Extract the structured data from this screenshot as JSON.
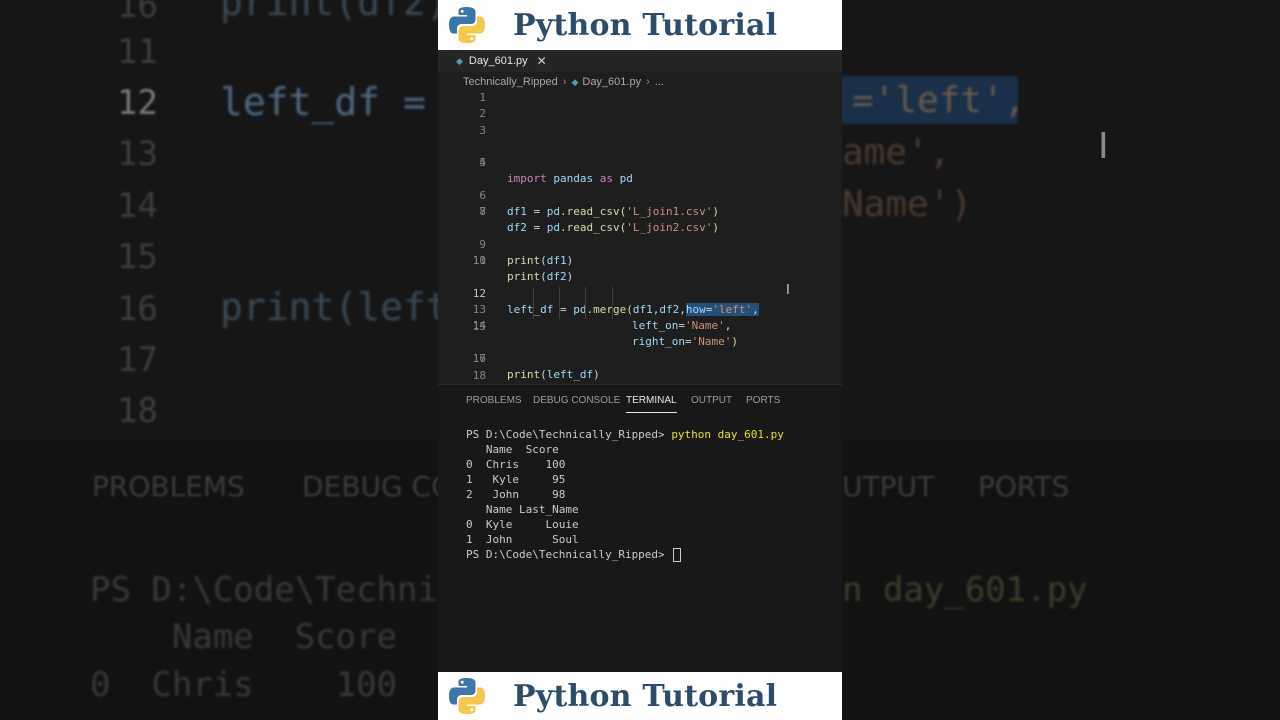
{
  "banner": {
    "title": "Python Tutorial"
  },
  "editor": {
    "tab_label": "Day_601.py",
    "close_glyph": "✕",
    "breadcrumb": {
      "folder": "Technically_Ripped",
      "file": "Day_601.py",
      "more": "..."
    },
    "lines": [
      {
        "n": "1"
      },
      {
        "n": "2"
      },
      {
        "n": "3"
      },
      {
        "n": "4",
        "import_kw": "import",
        "module": "pandas",
        "as_kw": "as",
        "alias": "pd"
      },
      {
        "n": "5"
      },
      {
        "n": "6",
        "var": "df1",
        "eq": " = ",
        "obj": "pd",
        "call": ".read_csv(",
        "str": "'L_join1.csv'",
        "close": ")"
      },
      {
        "n": "7",
        "var": "df2",
        "eq": " = ",
        "obj": "pd",
        "call": ".read_csv(",
        "str": "'L_join2.csv'",
        "close": ")"
      },
      {
        "n": "8"
      },
      {
        "n": "9",
        "fn": "print",
        "open": "(",
        "arg": "df1",
        "close": ")"
      },
      {
        "n": "10",
        "fn": "print",
        "open": "(",
        "arg": "df2",
        "close": ")"
      },
      {
        "n": "11"
      },
      {
        "n": "12",
        "var": "left_df",
        "eq": " = ",
        "obj": "pd",
        "call": ".merge(",
        "args": "df1,df2,",
        "kwarg": "how",
        "kweq": "=",
        "str": "'left'",
        "comma": ","
      },
      {
        "n": "13",
        "kwarg": "left_on",
        "kweq": "=",
        "str": "'Name'",
        "comma": ","
      },
      {
        "n": "14",
        "kwarg": "right_on",
        "kweq": "=",
        "str": "'Name'",
        "close": ")"
      },
      {
        "n": "15"
      },
      {
        "n": "16",
        "fn": "print",
        "open": "(",
        "arg": "left_df",
        "close": ")"
      },
      {
        "n": "17"
      },
      {
        "n": "18"
      }
    ]
  },
  "panel": {
    "tabs": [
      "PROBLEMS",
      "DEBUG CONSOLE",
      "TERMINAL",
      "OUTPUT",
      "PORTS"
    ],
    "active_tab": "TERMINAL",
    "terminal": {
      "prompt": "PS D:\\Code\\Technically_Ripped> ",
      "command": "python day_601.py",
      "output": [
        "   Name  Score",
        "0  Chris    100",
        "1   Kyle     95",
        "2   John     98",
        "   Name Last_Name",
        "0  Kyle     Louie",
        "1  John      Soul"
      ]
    }
  },
  "background": {
    "line_numbers": [
      "16",
      "11",
      "12",
      "13",
      "14",
      "15",
      "16",
      "17",
      "18"
    ],
    "code_frag_1": "print(df2)",
    "code_frag_12": "left_df = p",
    "code_frag_16": "print(left_",
    "right_frag_12": "='left',",
    "right_frag_13": "ame',",
    "right_frag_14": "Name')",
    "tab_problems": "PROBLEMS",
    "tab_debug": "DEBUG CO",
    "tab_output": "UTPUT",
    "tab_ports": "PORTS",
    "term_frag_1": "PS D:\\Code\\Techni",
    "term_frag_1_right": "n day_601.py",
    "term_frag_2": "    Name  Score",
    "term_frag_3": "0  Chris    100"
  },
  "colors": {
    "banner_text": "#2d4b6b",
    "python_blue": "#3d76a8",
    "python_yellow": "#f2c94c",
    "selection": "#264f78"
  }
}
